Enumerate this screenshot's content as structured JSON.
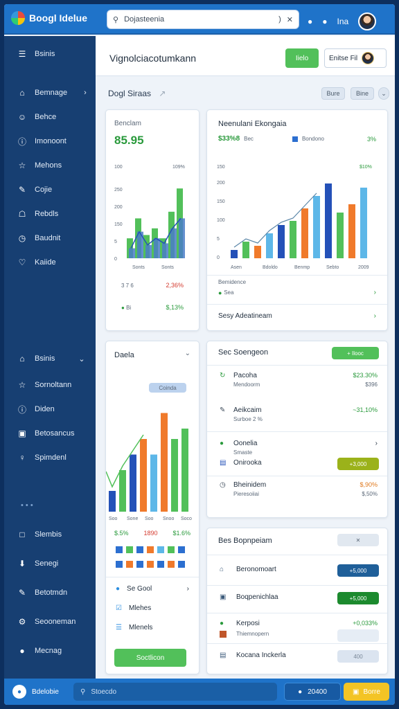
{
  "topbar": {
    "app_title": "Boogl Idelue",
    "search_placeholder": "Dojasteenia",
    "search_caret": ")",
    "icons": [
      "close-icon",
      "bell-icon",
      "settings-icon"
    ],
    "icon_label": "Ina"
  },
  "sidebar": {
    "header": "Bsinis",
    "items": [
      {
        "label": "Bemnage",
        "icon": "home-icon"
      },
      {
        "label": "Behce",
        "icon": "user-icon"
      },
      {
        "label": "Imonoont",
        "icon": "info-icon"
      },
      {
        "label": "Mehons",
        "icon": "star-icon"
      },
      {
        "label": "Cojie",
        "icon": "edit-icon"
      },
      {
        "label": "Rebdls",
        "icon": "bank-icon"
      },
      {
        "label": "Baudnit",
        "icon": "clock-icon"
      },
      {
        "label": "Kaiide",
        "icon": "heart-icon"
      }
    ],
    "section2_header": "Bsinis",
    "items2": [
      {
        "label": "Sornoltann",
        "icon": "star-icon"
      },
      {
        "label": "Diden",
        "icon": "info-icon"
      },
      {
        "label": "Betosancus",
        "icon": "window-icon"
      },
      {
        "label": "Spimdenl",
        "icon": "person-icon"
      }
    ],
    "items3": [
      {
        "label": "Slembis",
        "icon": "square-icon"
      },
      {
        "label": "Senegi",
        "icon": "download-icon"
      },
      {
        "label": "Betotmdn",
        "icon": "edit-icon"
      },
      {
        "label": "Seooneman",
        "icon": "gear-icon"
      },
      {
        "label": "Mecnag",
        "icon": "circle-icon"
      }
    ]
  },
  "header": {
    "title": "Vignolciacotumkann",
    "primary_button": "Iielo",
    "user_chip": "Enitse Fil"
  },
  "subheader": {
    "title": "Dogl Siraas",
    "pill1": "Bure",
    "pill2": "Bine"
  },
  "card_stats": {
    "label": "Benclam",
    "value": "85.95",
    "y_top_label": "100",
    "y_top_right": "109%",
    "y_ticks": [
      "250",
      "200",
      "150",
      "5",
      "0"
    ],
    "x_labels": [
      "Sonts",
      "Sonts"
    ],
    "row1_left": "3 7 6",
    "row1_right": "2,36%",
    "row2_left": "Bi",
    "row2_right": "$,13%"
  },
  "card_trend": {
    "title": "Neenulani Ekongaia",
    "value": "$33%8",
    "value_tag": "Bec",
    "legend": "Bondono",
    "legend_value": "3%",
    "y_top_label": "150",
    "y_top_right": "$10%",
    "y_ticks": [
      "200",
      "150",
      "100",
      "5",
      "0"
    ],
    "x_labels": [
      "Asen",
      "Bdoldo",
      "Benmp",
      "Sebto",
      "2009"
    ],
    "sub_label": "Bemidence",
    "sub_item": "Sea",
    "footer": "Sesy Adeatineam"
  },
  "card_bars": {
    "title": "Daela",
    "chip": "Coinda",
    "x_labels": [
      "Soo",
      "Sone",
      "Soo",
      "Snoo",
      "Soco"
    ],
    "stat1": "$.5%",
    "stat2": "1890",
    "stat3": "$1.6%",
    "items": [
      {
        "label": "Se Gool",
        "icon": "blue-circle-icon"
      },
      {
        "label": "Mlehes",
        "icon": "checkbox-icon"
      },
      {
        "label": "Mlenels",
        "icon": "list-icon"
      }
    ],
    "button": "Soctlicon"
  },
  "card_list": {
    "title": "Sec Soengeon",
    "badge": "+ Ilooc",
    "rows": [
      {
        "title": "Pacoha",
        "sub": "Mendoorm",
        "value": "$23.30%",
        "sub_value": "$396"
      },
      {
        "title": "Aeikcaim",
        "sub": "Surboe 2 %",
        "value": "~31,10%",
        "sub_value": ""
      },
      {
        "title": "Oonelia",
        "sub": "Smaste",
        "value": "",
        "sub_value": ""
      },
      {
        "title": "Onirooka",
        "sub": "",
        "value": "+3,000",
        "sub_value": ""
      },
      {
        "title": "Bheinidem",
        "sub": "Pieresoiiai",
        "value": "$,90%",
        "sub_value": "$,50%"
      }
    ]
  },
  "card_actions": {
    "title": "Bes Bopnpeiam",
    "rows": [
      {
        "label": "Beronomoart",
        "badge": "+5,000"
      },
      {
        "label": "Boqpenichlaa",
        "badge": "+5,000"
      },
      {
        "label": "Kerposi",
        "value": "+0,033%",
        "sub": "Thiemnopern"
      },
      {
        "label": "Kocana Inckerla",
        "badge": "400"
      }
    ]
  },
  "bottombar": {
    "app_label": "Bdelobie",
    "search_placeholder": "Stoecdo",
    "btn1": "20400",
    "btn2": "Borre"
  },
  "colors": {
    "blue": "#1f73c9",
    "green": "#52c05a",
    "orange": "#f07a2b",
    "light_blue": "#5db7e8",
    "dark_blue": "#2451b8",
    "navy": "#173f72"
  },
  "chart_data": [
    {
      "type": "bar",
      "title": "Benclam",
      "categories": [
        "1",
        "2",
        "3",
        "4",
        "5",
        "6",
        "7"
      ],
      "series": [
        {
          "values": [
            60,
            120,
            70,
            90,
            60,
            140,
            210
          ]
        },
        {
          "values": [
            30,
            80,
            40,
            60,
            45,
            90,
            120
          ]
        }
      ],
      "ylim": [
        0,
        250
      ],
      "x_tick_labels": [
        "Sonts",
        "Sonts"
      ]
    },
    {
      "type": "bar",
      "title": "Neenulani Ekongaia",
      "categories": [
        "1",
        "2",
        "3",
        "4",
        "5",
        "6",
        "7",
        "8",
        "9",
        "10",
        "11",
        "12"
      ],
      "values": [
        20,
        40,
        30,
        60,
        80,
        90,
        120,
        150,
        180,
        110,
        130,
        170
      ],
      "ylim": [
        0,
        200
      ],
      "x_tick_labels": [
        "Asen",
        "Bdoldo",
        "Benmp",
        "Sebto",
        "2009"
      ]
    },
    {
      "type": "bar",
      "title": "Daela",
      "categories": [
        "1",
        "2",
        "3",
        "4",
        "5",
        "6",
        "7",
        "8"
      ],
      "values": [
        40,
        80,
        110,
        140,
        110,
        190,
        140,
        160
      ],
      "ylim": [
        0,
        200
      ],
      "x_tick_labels": [
        "Soo",
        "Sone",
        "Soo",
        "Snoo",
        "Soco"
      ]
    }
  ]
}
